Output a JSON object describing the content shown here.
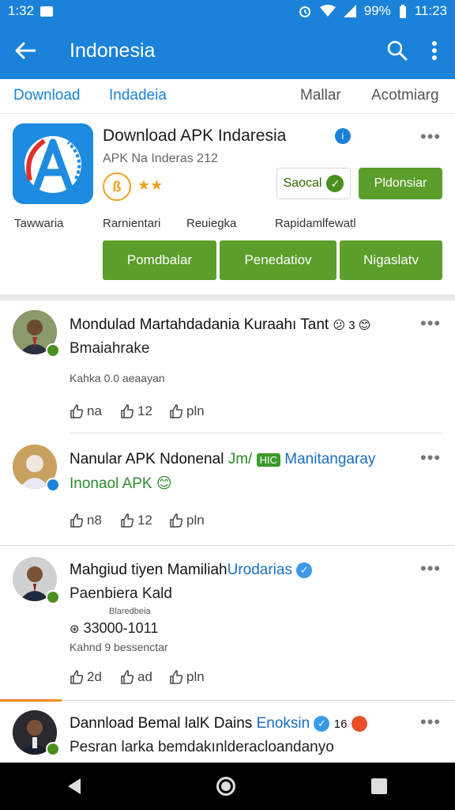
{
  "status": {
    "time_left": "1:32",
    "battery": "99%",
    "time_right": "11:23"
  },
  "app_bar": {
    "title": "Indonesia"
  },
  "tabs": [
    "Download",
    "Indadeia",
    "Mallar",
    "Acotmiarg"
  ],
  "app": {
    "name": "Download APK Indaresia",
    "subtitle": "APK Na Inderas 212",
    "rating_letter": "ß",
    "saved_label": "Saocal",
    "primary_label": "Pldonsiar",
    "meta": [
      "Tawwaria",
      "Rarnientari",
      "Reuiegka",
      "Rapidamlfewatl"
    ],
    "buttons": [
      "Pomdbalar",
      "Penedatiov",
      "Nigaslatv"
    ]
  },
  "posts": [
    {
      "name": "Mondulad Martahdadania Kuraahı Tant",
      "emoji": "😕 3 😊",
      "text": "Bmaiahrake",
      "small": "Kahka 0.0 aeaayan",
      "likes": "na",
      "shares": "12",
      "comments": "pln"
    },
    {
      "name_plain": "Nanular APK Ndonenal",
      "name_link": "Jm/",
      "badge": "HIC",
      "name_tail": "Manitangaray",
      "text": "Inonaol APK",
      "emoji": "😊",
      "likes": "n8",
      "shares": "12",
      "comments": "pln"
    },
    {
      "name_plain": "Mahgiud tiyen Mamiliah",
      "name_link": "Urodarias",
      "text": "Paenbiera Kald",
      "tiny": "Blaredbeia",
      "phone": "33000-1011",
      "small": "Kahnd 9 bessenctar",
      "likes": "2d",
      "shares": "ad",
      "comments": "pln"
    },
    {
      "name_plain": "Dannload Bemal lalK Dains",
      "name_link": "Enoksin",
      "count": "16",
      "text": "Pesran larka bemdakınlderacloandanyo"
    }
  ]
}
